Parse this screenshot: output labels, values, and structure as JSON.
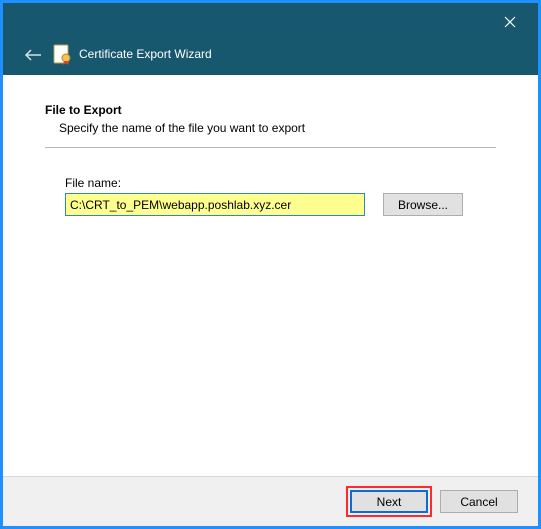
{
  "header": {
    "title": "Certificate Export Wizard"
  },
  "section": {
    "title": "File to Export",
    "subtitle": "Specify the name of the file you want to export"
  },
  "field": {
    "label": "File name:",
    "value": "C:\\CRT_to_PEM\\webapp.poshlab.xyz.cer",
    "browse": "Browse..."
  },
  "footer": {
    "next": "Next",
    "cancel": "Cancel"
  }
}
